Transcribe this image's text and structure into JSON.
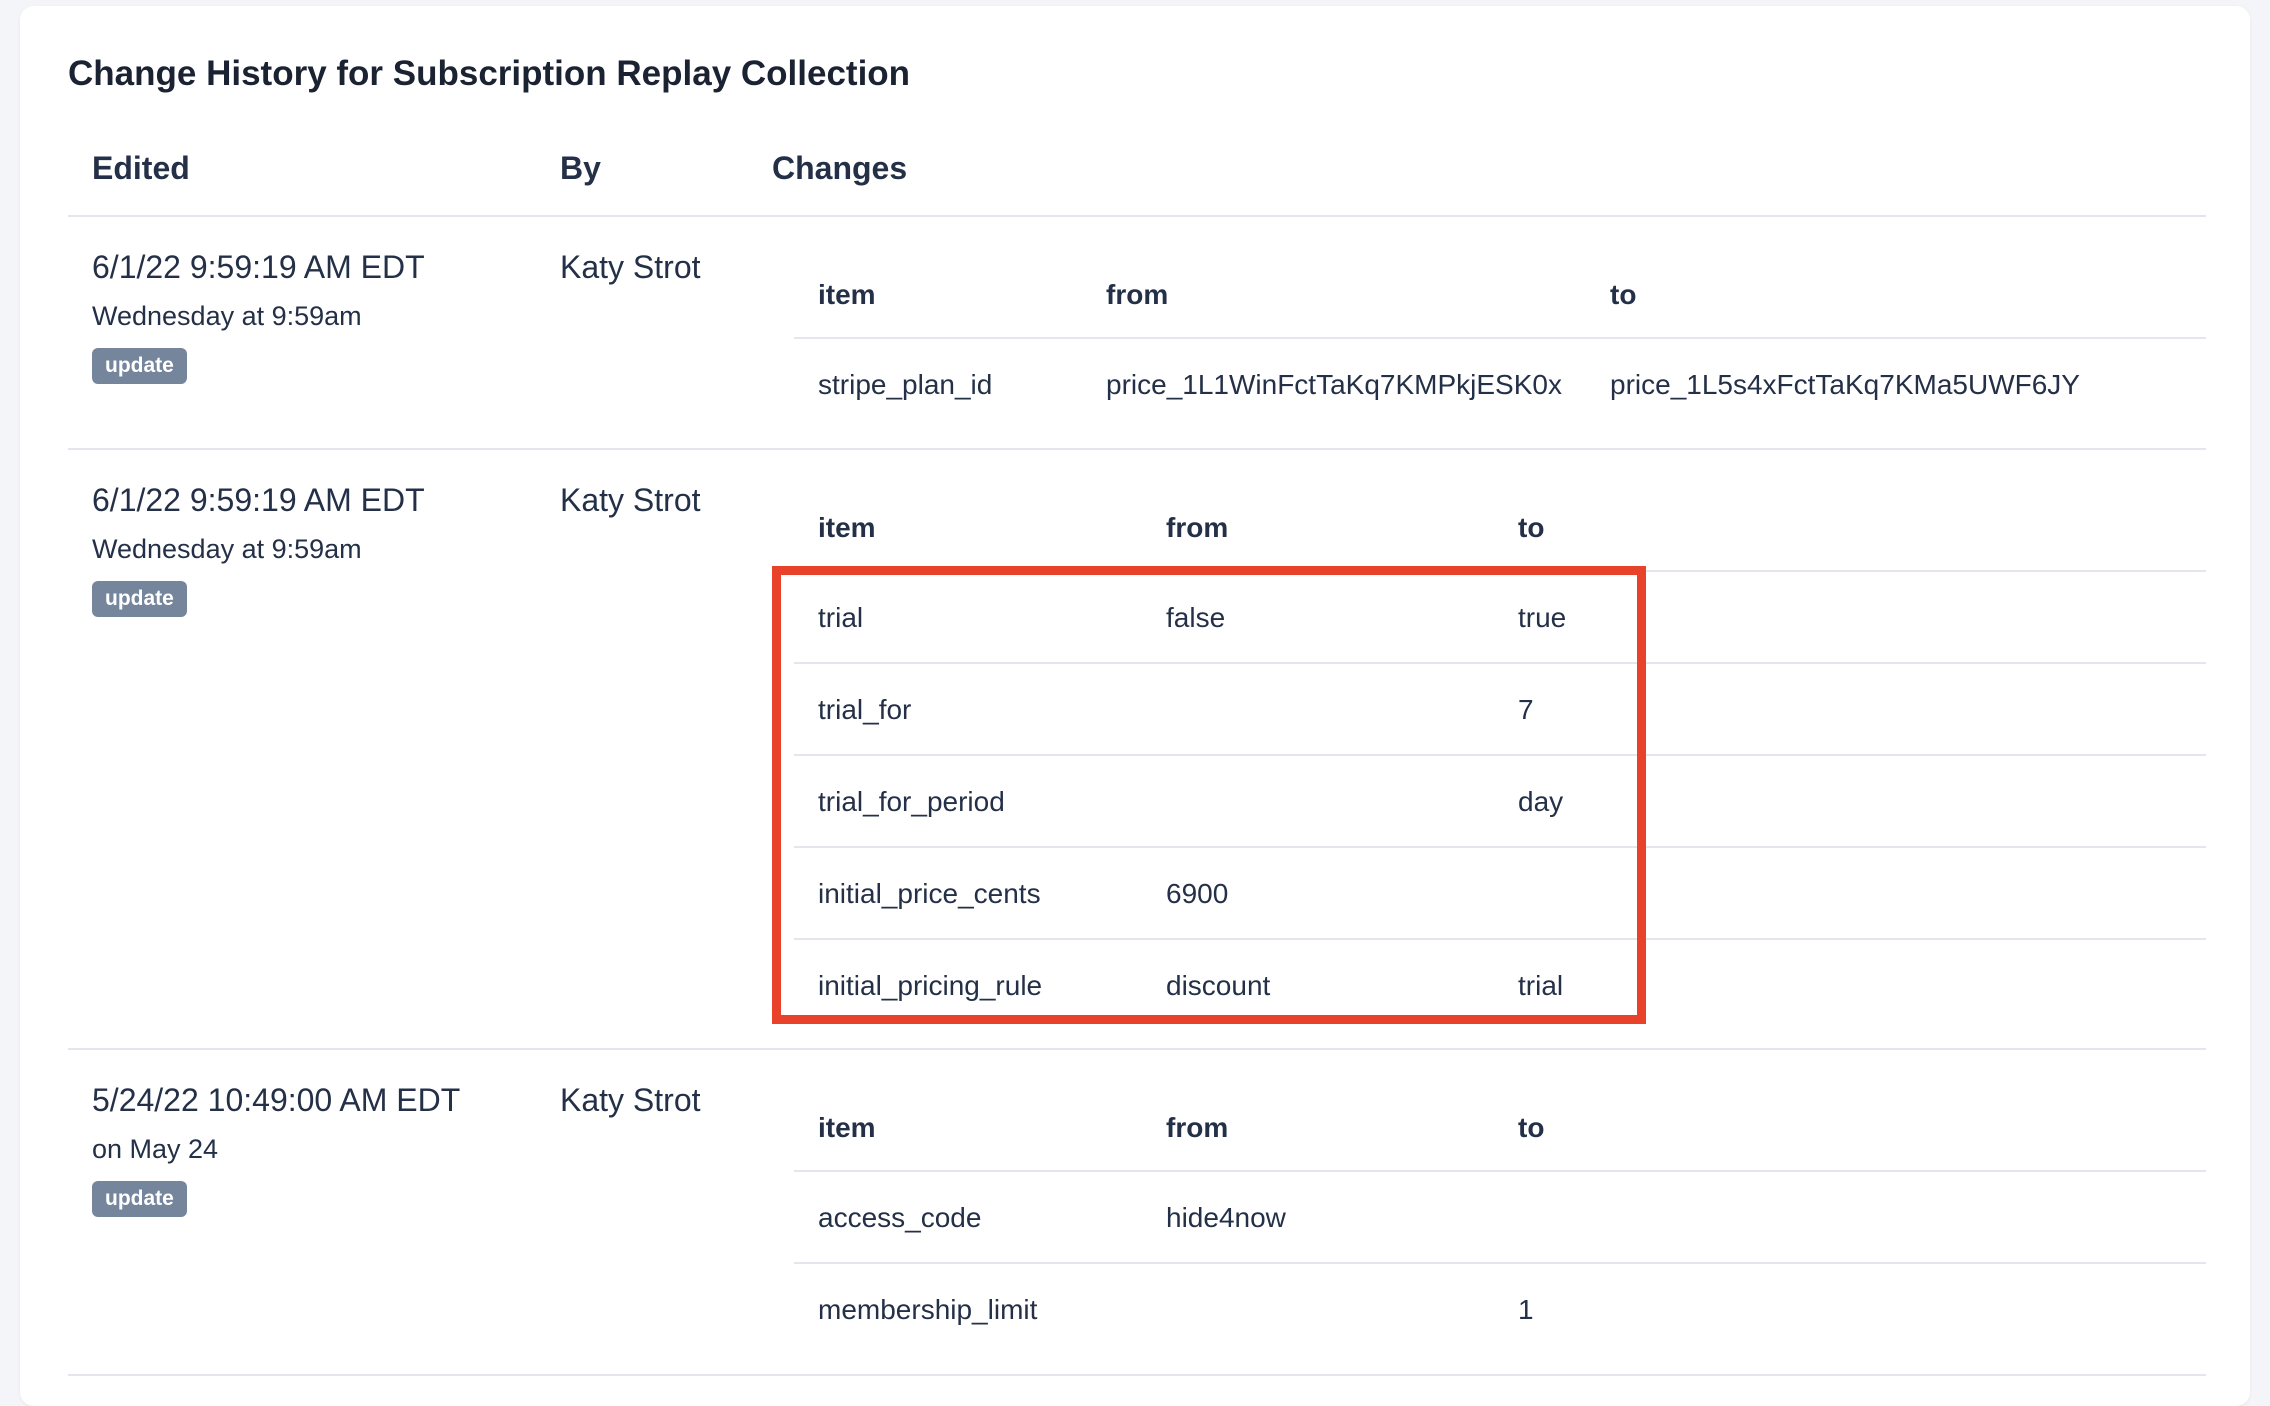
{
  "page": {
    "title": "Change History for Subscription Replay Collection"
  },
  "columns": {
    "edited": "Edited",
    "by": "By",
    "changes": "Changes"
  },
  "change_columns": {
    "item": "item",
    "from": "from",
    "to": "to"
  },
  "entries": [
    {
      "date": "6/1/22 9:59:19 AM EDT",
      "relative": "Wednesday at 9:59am",
      "badge": "update",
      "editor": "Katy Strot",
      "rows": [
        {
          "item": "stripe_plan_id",
          "from": "price_1L1WinFctTaKq7KMPkjESK0x",
          "to": "price_1L5s4xFctTaKq7KMa5UWF6JY"
        }
      ]
    },
    {
      "date": "6/1/22 9:59:19 AM EDT",
      "relative": "Wednesday at 9:59am",
      "badge": "update",
      "editor": "Katy Strot",
      "rows": [
        {
          "item": "trial",
          "from": "false",
          "to": "true"
        },
        {
          "item": "trial_for",
          "from": "",
          "to": "7"
        },
        {
          "item": "trial_for_period",
          "from": "",
          "to": "day"
        },
        {
          "item": "initial_price_cents",
          "from": "6900",
          "to": ""
        },
        {
          "item": "initial_pricing_rule",
          "from": "discount",
          "to": "trial"
        }
      ]
    },
    {
      "date": "5/24/22 10:49:00 AM EDT",
      "relative": "on May 24",
      "badge": "update",
      "editor": "Katy Strot",
      "rows": [
        {
          "item": "access_code",
          "from": "hide4now",
          "to": ""
        },
        {
          "item": "membership_limit",
          "from": "",
          "to": "1"
        }
      ]
    }
  ],
  "colors": {
    "text": "#243047",
    "badge_bg": "#75859c",
    "divider": "#e3e6ec",
    "highlight": "#e8432a"
  }
}
